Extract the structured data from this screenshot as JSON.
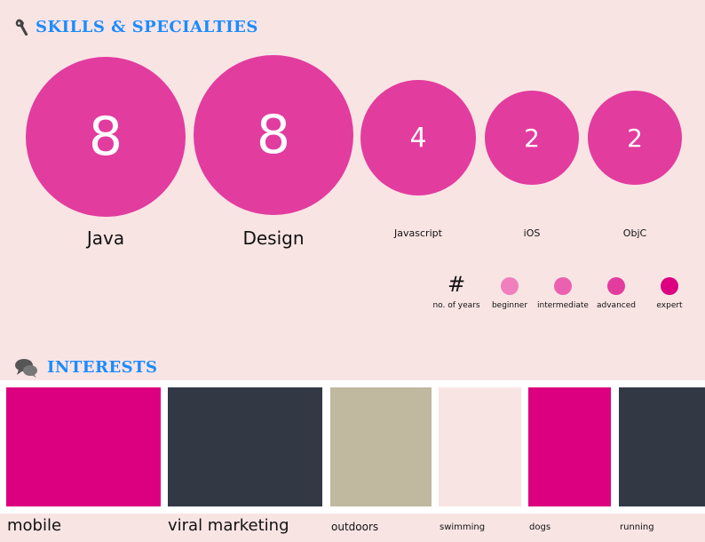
{
  "skills_section": {
    "icon": "wrench-icon",
    "title": "SKILLS & SPECIALTIES",
    "skills": [
      {
        "name": "Java",
        "years": "8"
      },
      {
        "name": "Design",
        "years": "8"
      },
      {
        "name": "Javascript",
        "years": "4"
      },
      {
        "name": "iOS",
        "years": "2"
      },
      {
        "name": "ObjC",
        "years": "2"
      }
    ],
    "legend": {
      "hash_symbol": "#",
      "hash_label": "no. of years",
      "levels": [
        {
          "label": "beginner",
          "color": "#f07fbd"
        },
        {
          "label": "intermediate",
          "color": "#eb60b0"
        },
        {
          "label": "advanced",
          "color": "#e23c9f"
        },
        {
          "label": "expert",
          "color": "#dc0081"
        }
      ]
    }
  },
  "interests_section": {
    "icon": "chat-bubbles-icon",
    "title": "INTERESTS",
    "items": [
      {
        "label": "mobile",
        "color": "#dc0081"
      },
      {
        "label": "viral marketing",
        "color": "#323844"
      },
      {
        "label": "outdoors",
        "color": "#c1b8a0"
      },
      {
        "label": "swimming",
        "color": "#f9e4e4"
      },
      {
        "label": "dogs",
        "color": "#dc0081"
      },
      {
        "label": "running",
        "color": "#323844"
      }
    ]
  },
  "colors": {
    "background": "#f9e4e4",
    "accent_blue": "#1a8cff",
    "skill_circle": "#e23c9f"
  }
}
